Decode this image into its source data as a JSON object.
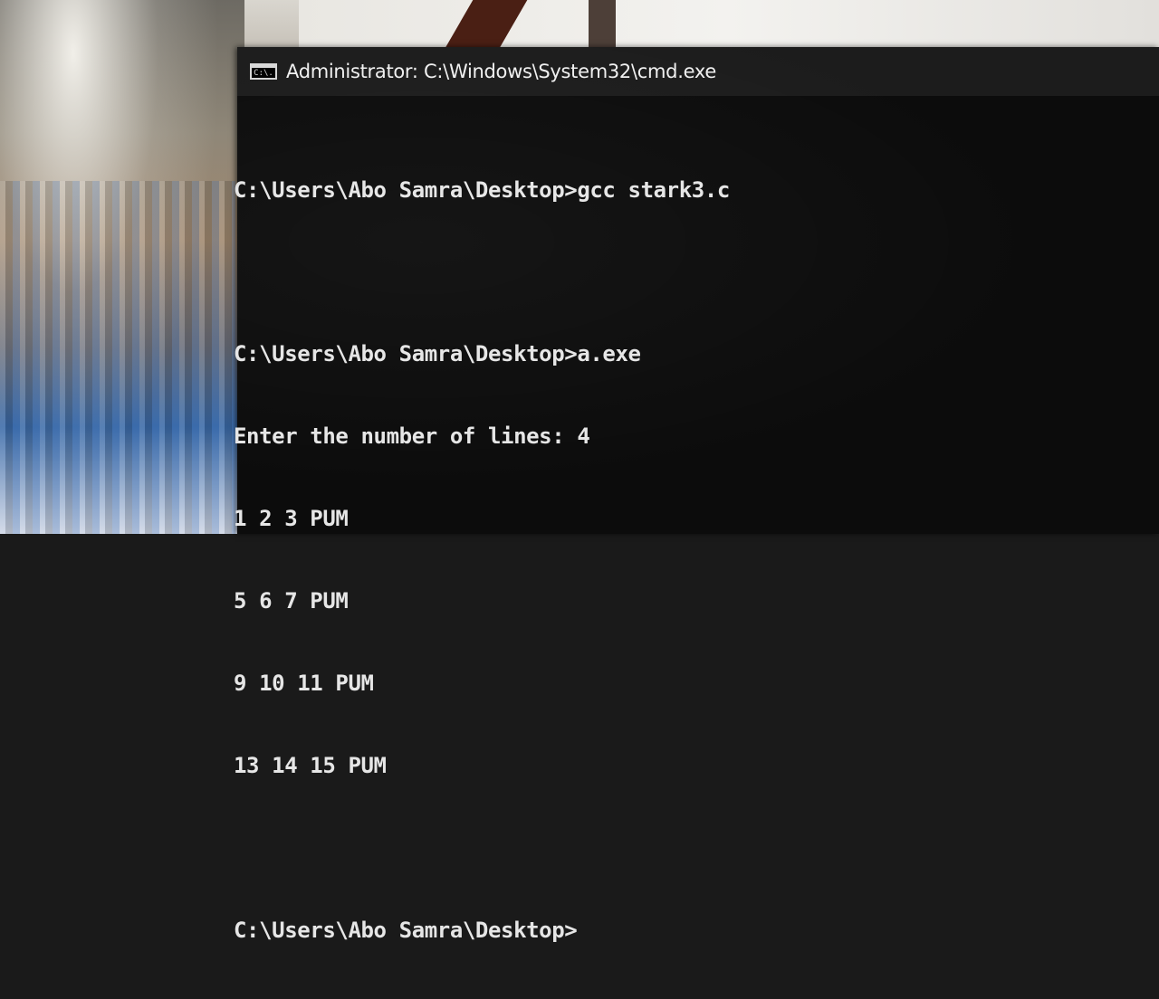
{
  "window": {
    "title": "Administrator: C:\\Windows\\System32\\cmd.exe",
    "icon_text": "C:\\."
  },
  "console": {
    "lines": [
      "C:\\Users\\Abo Samra\\Desktop>gcc stark3.c",
      "",
      "C:\\Users\\Abo Samra\\Desktop>a.exe",
      "Enter the number of lines: 4",
      "1 2 3 PUM",
      "5 6 7 PUM",
      "9 10 11 PUM",
      "13 14 15 PUM",
      "",
      "C:\\Users\\Abo Samra\\Desktop>"
    ]
  },
  "colors": {
    "console_bg": "#0c0c0c",
    "console_text": "#e6e6e6",
    "titlebar_bg": "#1c1c1c"
  }
}
